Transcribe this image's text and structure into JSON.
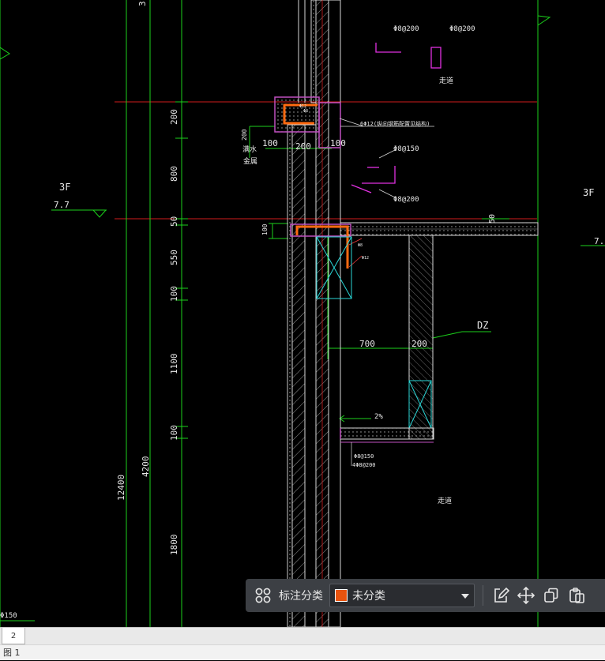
{
  "drawing": {
    "floor_left": "3F",
    "elev_left": "7.7",
    "floor_right": "3F",
    "elev_right": "7.",
    "dims_vertical": [
      "200",
      "800",
      "50",
      "550",
      "100",
      "1100",
      "100",
      "1800"
    ],
    "dim_total_a": "12400",
    "dim_total_b": "4200",
    "top_clip": "3",
    "dims_horizontal": [
      "100",
      "200",
      "100"
    ],
    "dims_horizontal_2": [
      "700",
      "200"
    ],
    "dim_50_right": "50",
    "dim_100_small": "100",
    "dim_200_small": "200",
    "rebar_top_a": "Φ8@200",
    "rebar_top_b": "Φ8@200",
    "corridor_top": "走道",
    "corridor_bottom": "走道",
    "leader_note": "6Φ12(纵向钢筋配置见结构)",
    "rebar_mid_a": "Φ8@150",
    "rebar_mid_b": "Φ8@200",
    "label_material": "满水",
    "label_material_2": "金属",
    "label_dz": "DZ",
    "slope": "2%",
    "rebar_bottom_a": "Φ8@150",
    "rebar_bottom_b": "4Φ8@200",
    "bottom_left_note": "Φ150",
    "small_red_a": "Φ12",
    "small_red_b": "Φ8",
    "small_red_c": "Φ8",
    "small_red_d": "Φ12"
  },
  "toolbar": {
    "group_icon": "grid-icon",
    "label": "标注分类",
    "dropdown_value": "未分类",
    "dropdown_color": "#e8530e",
    "edit_icon": "edit-icon",
    "move_icon": "move-icon",
    "copy_icon": "copy-icon",
    "paste_icon": "paste-icon"
  },
  "tabs": {
    "active": "2"
  },
  "status": {
    "text": "图 1"
  },
  "colors": {
    "background": "#000000",
    "grid_green": "#1bd11b",
    "level_red": "#d11b1b",
    "wall_white": "#d8d8d8",
    "purple": "#c050c0",
    "cyan": "#2ad6d6",
    "orange": "#ff6a10",
    "magenta": "#e030e0"
  }
}
